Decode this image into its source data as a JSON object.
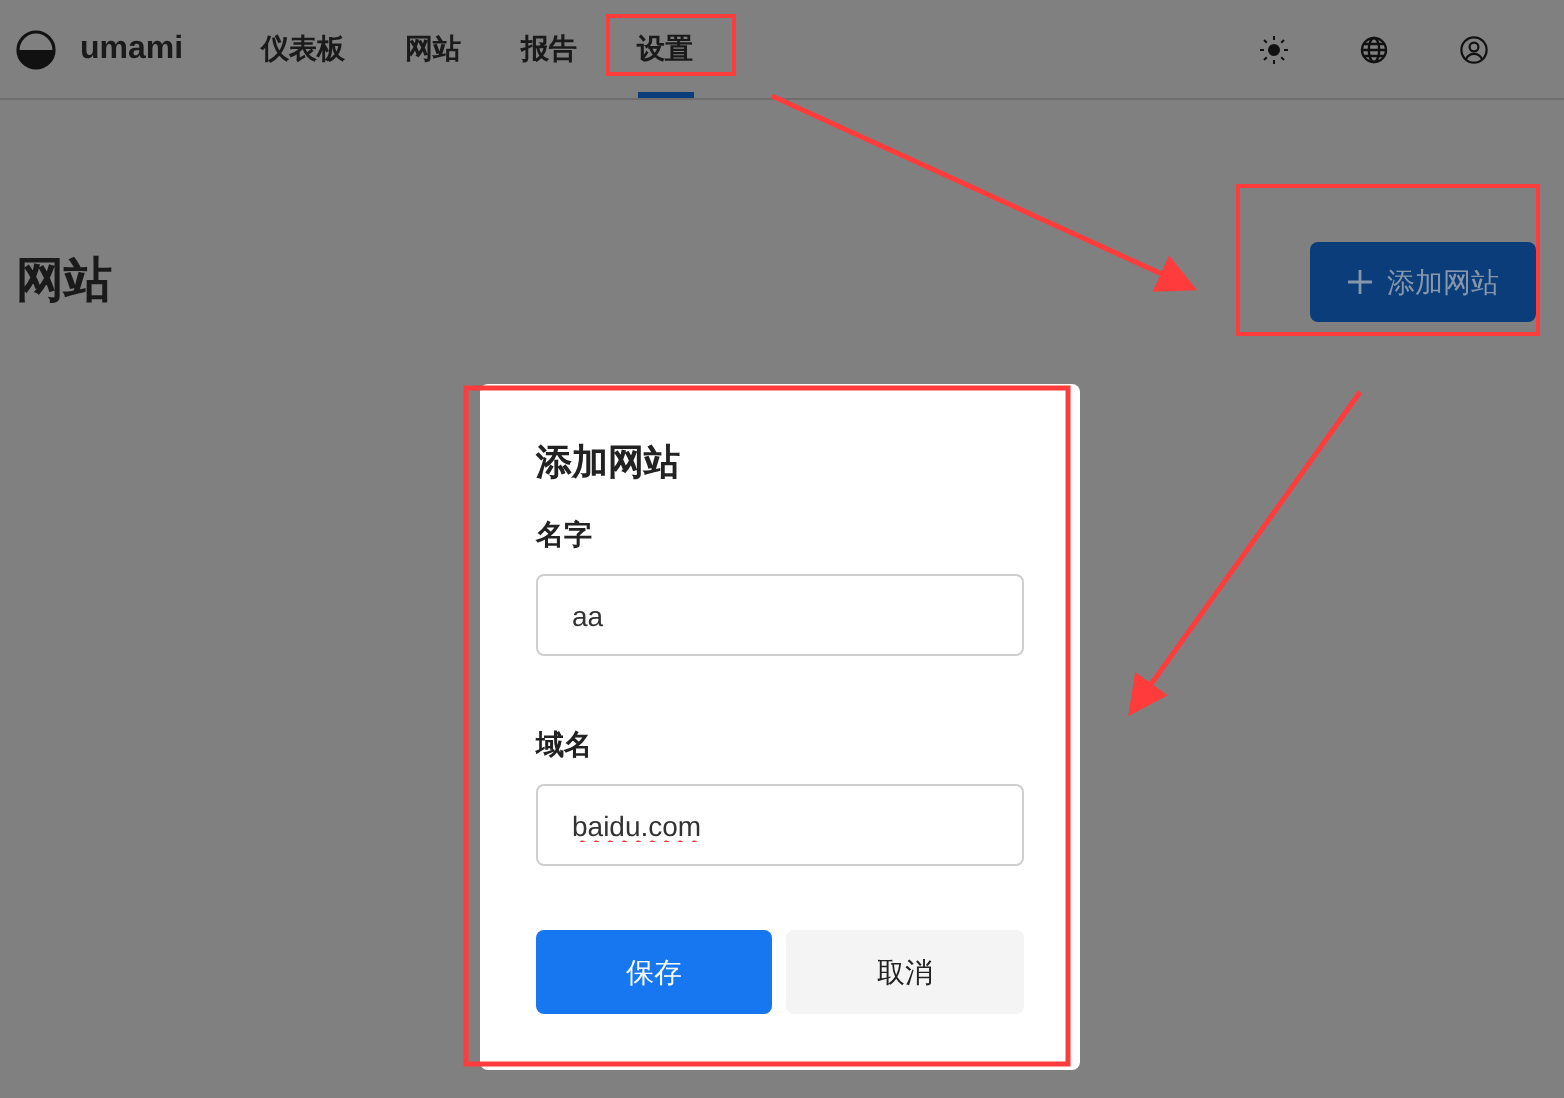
{
  "header": {
    "logo_text": "umami",
    "nav": [
      {
        "label": "仪表板",
        "selected": false
      },
      {
        "label": "网站",
        "selected": false
      },
      {
        "label": "报告",
        "selected": false
      },
      {
        "label": "设置",
        "selected": true
      }
    ]
  },
  "page": {
    "title": "网站",
    "add_button": "添加网站"
  },
  "dialog": {
    "title": "添加网站",
    "fields": [
      {
        "label": "名字",
        "value": "aa",
        "spellcheck_error": false
      },
      {
        "label": "域名",
        "value": "baidu.com",
        "spellcheck_error": true
      }
    ],
    "buttons": [
      {
        "label": "保存",
        "kind": "primary"
      },
      {
        "label": "取消",
        "kind": "secondary"
      }
    ]
  }
}
